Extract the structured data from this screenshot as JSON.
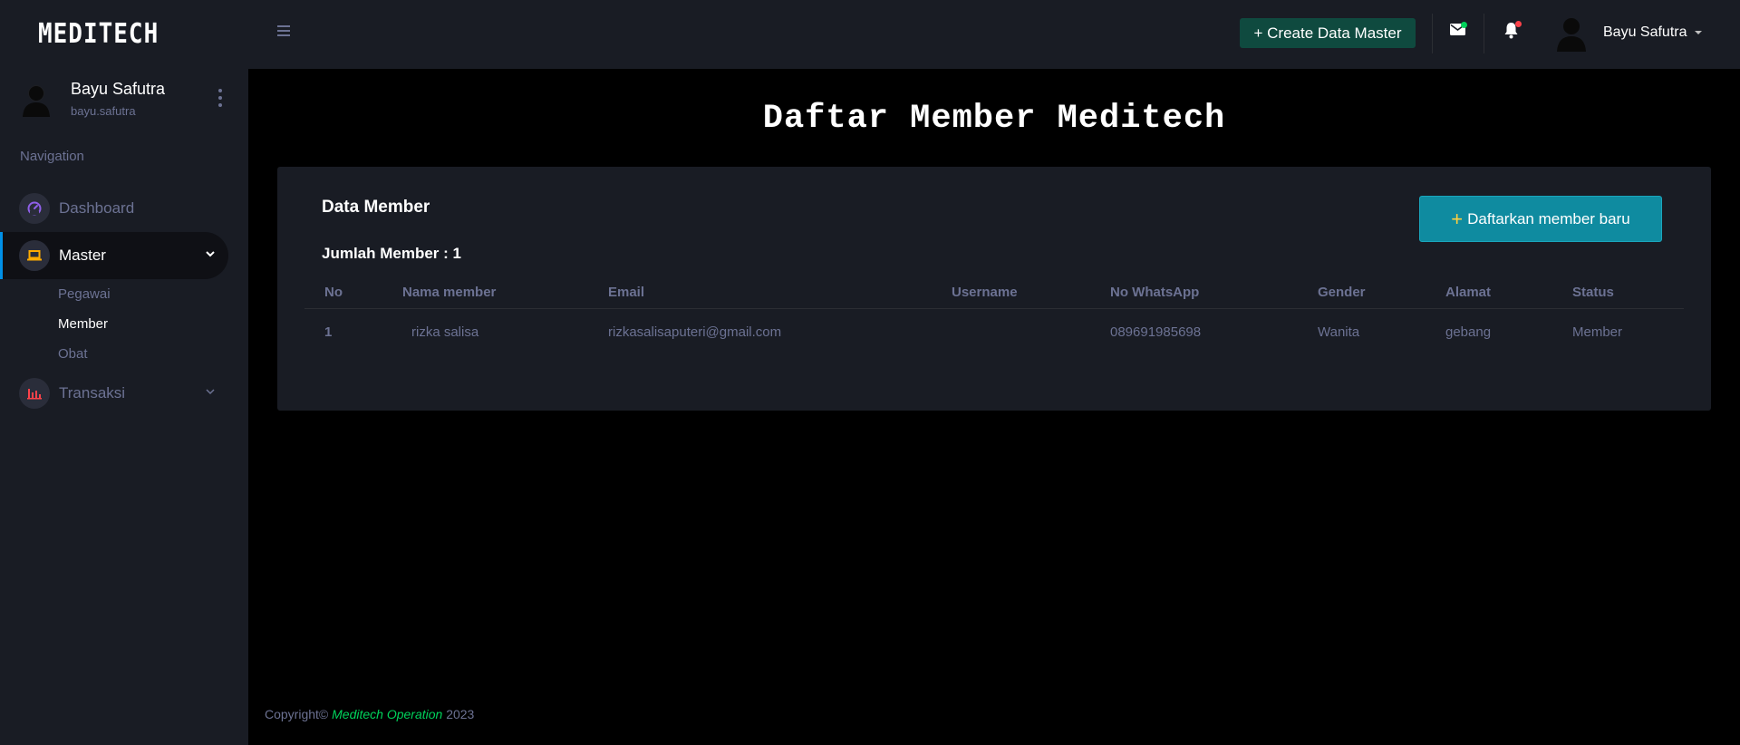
{
  "sidebar": {
    "brand": "MEDITECH",
    "profile": {
      "name": "Bayu Safutra",
      "username": "bayu.safutra"
    },
    "nav_title": "Navigation",
    "items": [
      {
        "label": "Dashboard",
        "icon": "speedometer-icon",
        "color": "#8f5fe8"
      },
      {
        "label": "Master",
        "icon": "laptop-icon",
        "color": "#ffab00",
        "active": true,
        "sub_items": [
          {
            "label": "Pegawai"
          },
          {
            "label": "Member",
            "active": true
          },
          {
            "label": "Obat"
          }
        ]
      },
      {
        "label": "Transaksi",
        "icon": "chart-bar-icon",
        "color": "#fc424a"
      }
    ]
  },
  "topbar": {
    "create_label": "+ Create Data Master",
    "user_name": "Bayu Safutra",
    "mail_status_color": "#00d25b",
    "bell_status_color": "#fc424a"
  },
  "main": {
    "title": "Daftar Member Meditech",
    "card": {
      "title": "Data Member",
      "count_label": "Jumlah Member : 1",
      "add_button": {
        "plus": "+",
        "label": "Daftarkan member baru"
      },
      "columns": [
        "No",
        "Nama member",
        "Email",
        "Username",
        "No WhatsApp",
        "Gender",
        "Alamat",
        "Status"
      ],
      "rows": [
        [
          "1",
          "rizka salisa",
          "rizkasalisaputeri@gmail.com",
          "",
          "089691985698",
          "Wanita",
          "gebang",
          "Member"
        ]
      ]
    }
  },
  "footer": {
    "prefix": "Copyright©",
    "brand": "Meditech Operation",
    "year": "2023"
  },
  "colors": {
    "accent_teal": "#0f8ba0",
    "accent_green": "#00d25b",
    "bg_panel": "#191c24"
  }
}
